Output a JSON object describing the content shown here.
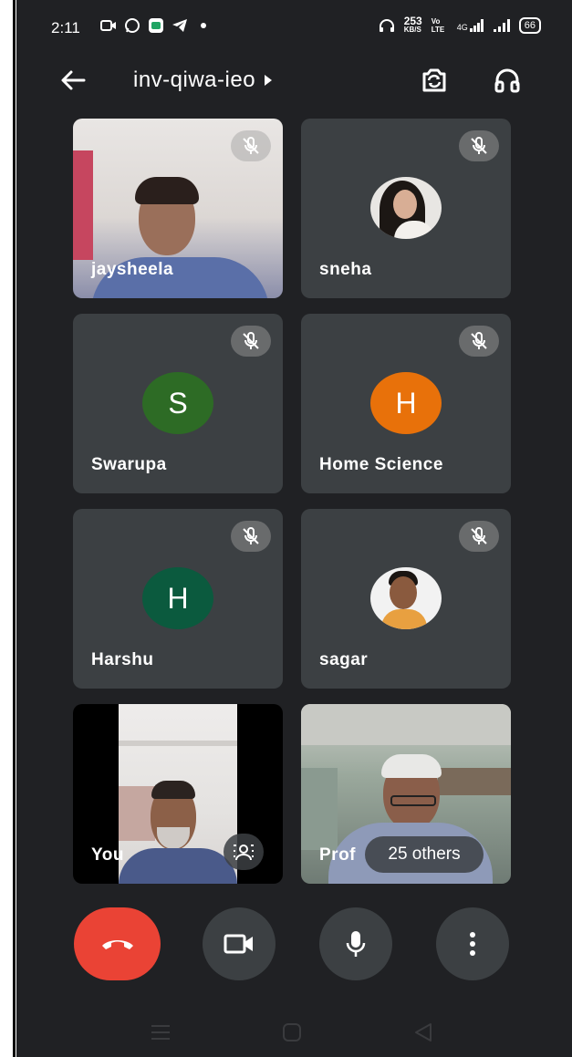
{
  "status_bar": {
    "time": "2:11",
    "network_speed": "253",
    "network_speed_unit": "KB/S",
    "volte": "Vo LTE",
    "network_type": "4G",
    "battery": "66"
  },
  "header": {
    "meeting_code": "inv-qiwa-ieo"
  },
  "participants": [
    {
      "name": "jaysheela",
      "type": "video",
      "muted": true
    },
    {
      "name": "sneha",
      "type": "photo",
      "muted": true
    },
    {
      "name": "Swarupa",
      "type": "letter",
      "letter": "S",
      "color": "#2d6b25",
      "muted": true
    },
    {
      "name": "Home Science",
      "type": "letter",
      "letter": "H",
      "color": "#e8710a",
      "muted": true
    },
    {
      "name": "Harshu",
      "type": "letter",
      "letter": "H",
      "color": "#0b5a3e",
      "muted": true
    },
    {
      "name": "sagar",
      "type": "photo",
      "muted": true
    },
    {
      "name": "You",
      "type": "video",
      "muted": false
    },
    {
      "name": "Prof",
      "type": "video",
      "muted": false
    }
  ],
  "others_count_label": "25 others",
  "colors": {
    "background": "#202124",
    "tile": "#3c4043",
    "hangup": "#ea4335"
  },
  "icons": [
    "back-arrow-icon",
    "flip-camera-icon",
    "headphones-icon",
    "mic-off-icon",
    "phone-hangup-icon",
    "video-camera-icon",
    "microphone-icon",
    "more-vert-icon",
    "effects-icon"
  ]
}
